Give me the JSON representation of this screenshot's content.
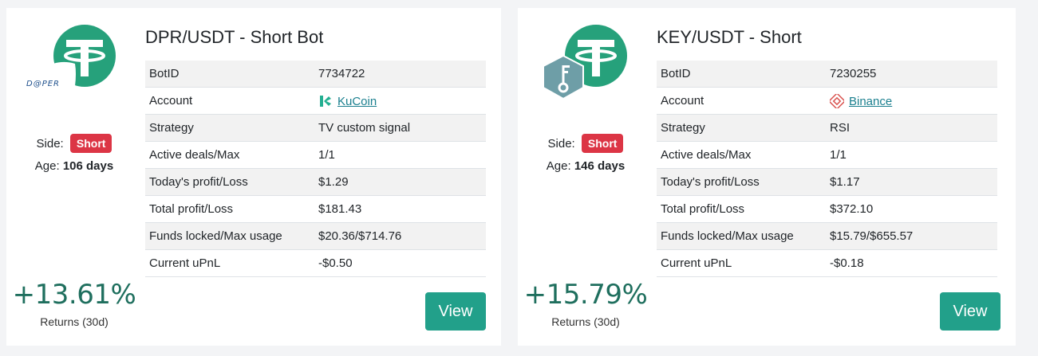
{
  "colors": {
    "accent": "#22a08a",
    "short_badge": "#dc3545",
    "returns_text": "#1f6f5e",
    "link": "#1a7f8e"
  },
  "bots": [
    {
      "title": "DPR/USDT - Short Bot",
      "icons": {
        "quote": "tether-icon",
        "base": "dpr-deeper-icon",
        "exchange": "kucoin-icon"
      },
      "side_label": "Side:",
      "side_value": "Short",
      "age_label": "Age:",
      "age_value": "106 days",
      "returns_value": "+13.61%",
      "returns_label": "Returns (30d)",
      "rows": [
        {
          "key": "BotID",
          "value": "7734722"
        },
        {
          "key": "Account",
          "value": "KuCoin"
        },
        {
          "key": "Strategy",
          "value": "TV custom signal"
        },
        {
          "key": "Active deals/Max",
          "value": "1/1"
        },
        {
          "key": "Today's profit/Loss",
          "value": "$1.29"
        },
        {
          "key": "Total profit/Loss",
          "value": "$181.43"
        },
        {
          "key": "Funds locked/Max usage",
          "value": "$20.36/$714.76"
        },
        {
          "key": "Current uPnL",
          "value": "-$0.50"
        }
      ],
      "view_label": "View"
    },
    {
      "title": "KEY/USDT - Short",
      "icons": {
        "quote": "tether-icon",
        "base": "selfkey-icon",
        "exchange": "binance-icon"
      },
      "side_label": "Side:",
      "side_value": "Short",
      "age_label": "Age:",
      "age_value": "146 days",
      "returns_value": "+15.79%",
      "returns_label": "Returns (30d)",
      "rows": [
        {
          "key": "BotID",
          "value": "7230255"
        },
        {
          "key": "Account",
          "value": "Binance"
        },
        {
          "key": "Strategy",
          "value": "RSI"
        },
        {
          "key": "Active deals/Max",
          "value": "1/1"
        },
        {
          "key": "Today's profit/Loss",
          "value": "$1.17"
        },
        {
          "key": "Total profit/Loss",
          "value": "$372.10"
        },
        {
          "key": "Funds locked/Max usage",
          "value": "$15.79/$655.57"
        },
        {
          "key": "Current uPnL",
          "value": "-$0.18"
        }
      ],
      "view_label": "View"
    }
  ]
}
